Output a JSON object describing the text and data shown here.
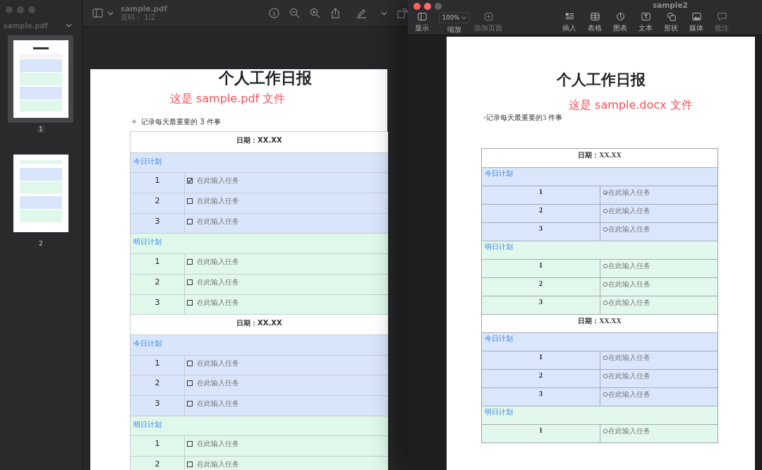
{
  "preview": {
    "sidebar": {
      "title": "sample.pdf",
      "thumbnails": [
        {
          "label": "1",
          "selected": true
        },
        {
          "label": "2",
          "selected": false
        }
      ]
    },
    "toolbar": {
      "title": "sample.pdf",
      "subtitle": "页码： 1/2"
    },
    "document": {
      "title": "个人工作日报",
      "label": "这是 sample.pdf 文件",
      "bullet": "✧",
      "note": "记录每天最重要的 3 件事",
      "blocks": [
        {
          "date": "日期：XX.XX",
          "groups": [
            {
              "label": "今日计划",
              "color": "#d9e5fb",
              "tasks": [
                {
                  "number": "1",
                  "text": "在此输入任务",
                  "checked": true
                },
                {
                  "number": "2",
                  "text": "在此输入任务",
                  "checked": false
                },
                {
                  "number": "3",
                  "text": "在此输入任务",
                  "checked": false
                }
              ]
            },
            {
              "label": "明日计划",
              "color": "#dff8ea",
              "tasks": [
                {
                  "number": "1",
                  "text": "在此输入任务",
                  "checked": false
                },
                {
                  "number": "2",
                  "text": "在此输入任务",
                  "checked": false
                },
                {
                  "number": "3",
                  "text": "在此输入任务",
                  "checked": false
                }
              ]
            }
          ]
        },
        {
          "date": "日期：XX.XX",
          "groups": [
            {
              "label": "今日计划",
              "color": "#d9e5fb",
              "tasks": [
                {
                  "number": "1",
                  "text": "在此输入任务",
                  "checked": false
                },
                {
                  "number": "2",
                  "text": "在此输入任务",
                  "checked": false
                },
                {
                  "number": "3",
                  "text": "在此输入任务",
                  "checked": false
                }
              ]
            },
            {
              "label": "明日计划",
              "color": "#dff8ea",
              "tasks": [
                {
                  "number": "1",
                  "text": "在此输入任务",
                  "checked": false
                },
                {
                  "number": "2",
                  "text": "在此输入任务",
                  "checked": false
                }
              ]
            }
          ]
        }
      ]
    }
  },
  "pages": {
    "window": {
      "title": "sample2"
    },
    "toolbar": {
      "items": [
        {
          "kind": "sidebar",
          "label": "显示",
          "disabled": false
        },
        {
          "kind": "zoom",
          "label": "缩放",
          "value": "100%",
          "disabled": false
        },
        {
          "kind": "add-page",
          "label": "添加页面",
          "disabled": true
        },
        {
          "kind": "insert",
          "label": "插入",
          "disabled": false
        },
        {
          "kind": "table",
          "label": "表格",
          "disabled": false
        },
        {
          "kind": "chart",
          "label": "图表",
          "disabled": false
        },
        {
          "kind": "text",
          "label": "文本",
          "disabled": false
        },
        {
          "kind": "shape",
          "label": "形状",
          "disabled": false
        },
        {
          "kind": "media",
          "label": "媒体",
          "disabled": false
        },
        {
          "kind": "comment",
          "label": "批注",
          "disabled": true
        }
      ]
    },
    "document": {
      "title": "个人工作日报",
      "label": "这是 sample.docx 文件",
      "bullet": "○",
      "note": "记录每天最重要的3 件事",
      "blocks": [
        {
          "date": "日期：XX.XX",
          "groups": [
            {
              "label": "今日计划",
              "color": "#dae6fc",
              "tasks": [
                {
                  "number": "1",
                  "text": "在此输入任务",
                  "checked": true
                },
                {
                  "number": "2",
                  "text": "在此输入任务",
                  "checked": false
                },
                {
                  "number": "3",
                  "text": "在此输入任务",
                  "checked": false
                }
              ]
            },
            {
              "label": "明日计划",
              "color": "#e2f8ec",
              "tasks": [
                {
                  "number": "1",
                  "text": "在此输入任务",
                  "checked": false
                },
                {
                  "number": "2",
                  "text": "在此输入任务",
                  "checked": false
                },
                {
                  "number": "3",
                  "text": "在此输入任务",
                  "checked": false
                }
              ]
            }
          ]
        },
        {
          "date": "日期：XX.XX",
          "groups": [
            {
              "label": "今日计划",
              "color": "#dae6fc",
              "tasks": [
                {
                  "number": "1",
                  "text": "在此输入任务",
                  "checked": false
                },
                {
                  "number": "2",
                  "text": "在此输入任务",
                  "checked": false
                },
                {
                  "number": "3",
                  "text": "在此输入任务",
                  "checked": false
                }
              ]
            },
            {
              "label": "明日计划",
              "color": "#e2f8ec",
              "tasks": [
                {
                  "number": "1",
                  "text": "在此输入任务",
                  "checked": false
                }
              ]
            }
          ]
        }
      ]
    }
  }
}
